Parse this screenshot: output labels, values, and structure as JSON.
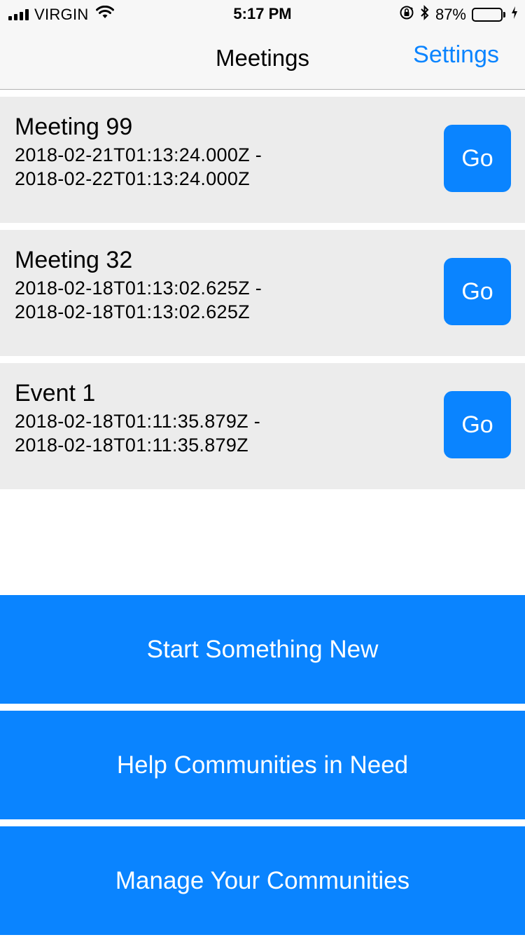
{
  "status_bar": {
    "carrier": "VIRGIN",
    "time": "5:17 PM",
    "battery_percent": "87%",
    "battery_level": 0.87,
    "battery_color": "#4cd964",
    "icons": [
      "signal-bars-icon",
      "wifi-icon",
      "orientation-lock-icon",
      "bluetooth-icon",
      "battery-icon",
      "charging-bolt-icon"
    ]
  },
  "nav": {
    "title": "Meetings",
    "settings_label": "Settings"
  },
  "meetings": [
    {
      "name": "Meeting 99",
      "start": "2018-02-21T01:13:24.000Z -",
      "end": "2018-02-22T01:13:24.000Z",
      "go_label": "Go"
    },
    {
      "name": "Meeting 32",
      "start": "2018-02-18T01:13:02.625Z -",
      "end": "2018-02-18T01:13:02.625Z",
      "go_label": "Go"
    },
    {
      "name": "Event 1",
      "start": "2018-02-18T01:11:35.879Z -",
      "end": "2018-02-18T01:11:35.879Z",
      "go_label": "Go"
    }
  ],
  "actions": {
    "start_new": "Start Something New",
    "help_communities": "Help Communities in Need",
    "manage_communities": "Manage Your Communities"
  },
  "colors": {
    "accent": "#0a84ff",
    "row_background": "#ececec",
    "bar_background": "#f7f7f7"
  }
}
